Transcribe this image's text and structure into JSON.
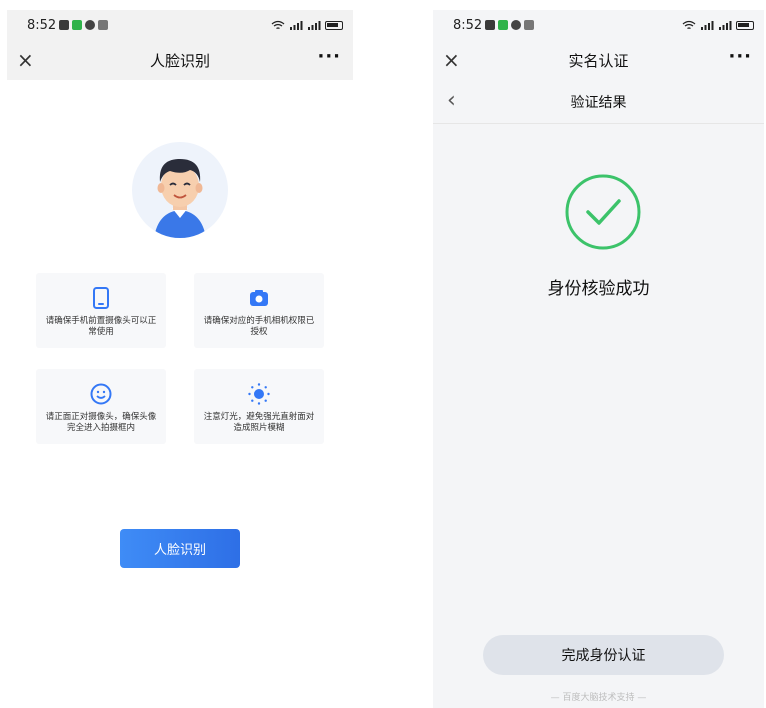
{
  "left": {
    "status": {
      "time": "8:52"
    },
    "nav": {
      "close": "×",
      "title": "人脸识别",
      "more": "···"
    },
    "tips": [
      {
        "text": "请确保手机前置摄像头可以正常使用",
        "icon": "phone-icon"
      },
      {
        "text": "请确保对应的手机相机权限已授权",
        "icon": "camera-icon"
      },
      {
        "text": "请正面正对摄像头，确保头像完全进入拍摄框内",
        "icon": "smile-face-icon"
      },
      {
        "text": "注意灯光，避免强光直射面对造成照片模糊",
        "icon": "sun-icon"
      }
    ],
    "button_label": "人脸识别"
  },
  "right": {
    "status": {
      "time": "8:52"
    },
    "nav": {
      "close": "×",
      "title": "实名认证",
      "more": "···"
    },
    "subnav": {
      "back": "‹",
      "title": "验证结果"
    },
    "result_text": "身份核验成功",
    "finish_button": "完成身份认证",
    "footer": "— 百度大脑技术支持 —"
  },
  "colors": {
    "accent": "#3478f6",
    "success": "#3cc36a"
  }
}
